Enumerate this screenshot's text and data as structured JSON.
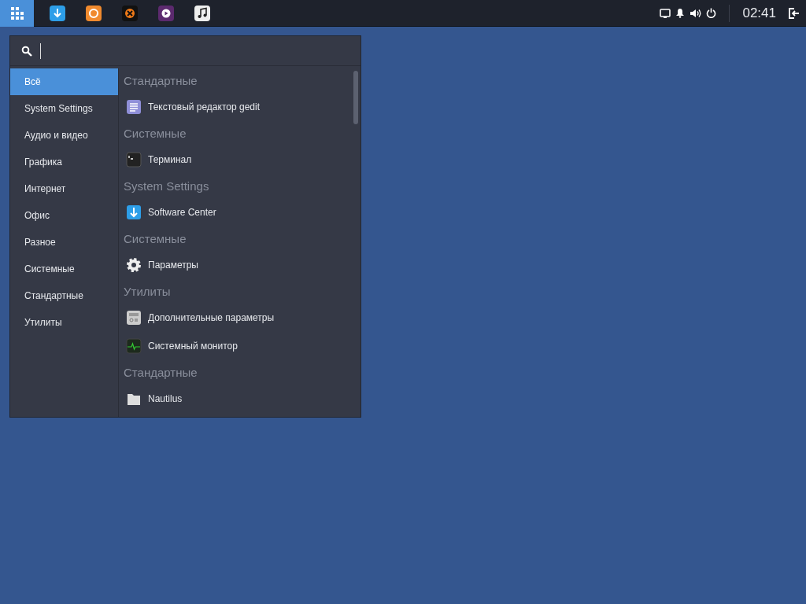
{
  "taskbar": {
    "launchers": [
      {
        "kind": "downloader"
      },
      {
        "kind": "browser"
      },
      {
        "kind": "media"
      },
      {
        "kind": "video"
      },
      {
        "kind": "music"
      }
    ],
    "clock": "02:41"
  },
  "menu": {
    "categories": [
      {
        "label": "Всё",
        "selected": true
      },
      {
        "label": "System Settings",
        "selected": false
      },
      {
        "label": "Аудио и видео",
        "selected": false
      },
      {
        "label": "Графика",
        "selected": false
      },
      {
        "label": "Интернет",
        "selected": false
      },
      {
        "label": "Офис",
        "selected": false
      },
      {
        "label": "Разное",
        "selected": false
      },
      {
        "label": "Системные",
        "selected": false
      },
      {
        "label": "Стандартные",
        "selected": false
      },
      {
        "label": "Утилиты",
        "selected": false
      }
    ],
    "entries": [
      {
        "kind": "header",
        "label": "Стандартные"
      },
      {
        "kind": "app",
        "label": "Текстовый редактор gedit"
      },
      {
        "kind": "header",
        "label": "Системные"
      },
      {
        "kind": "app",
        "label": "Терминал"
      },
      {
        "kind": "header",
        "label": "System Settings"
      },
      {
        "kind": "app",
        "label": "Software Center"
      },
      {
        "kind": "header",
        "label": "Системные"
      },
      {
        "kind": "app",
        "label": "Параметры"
      },
      {
        "kind": "header",
        "label": "Утилиты"
      },
      {
        "kind": "app",
        "label": "Дополнительные параметры"
      },
      {
        "kind": "app",
        "label": "Системный монитор"
      },
      {
        "kind": "header",
        "label": "Стандартные"
      },
      {
        "kind": "app",
        "label": "Nautilus"
      }
    ]
  }
}
